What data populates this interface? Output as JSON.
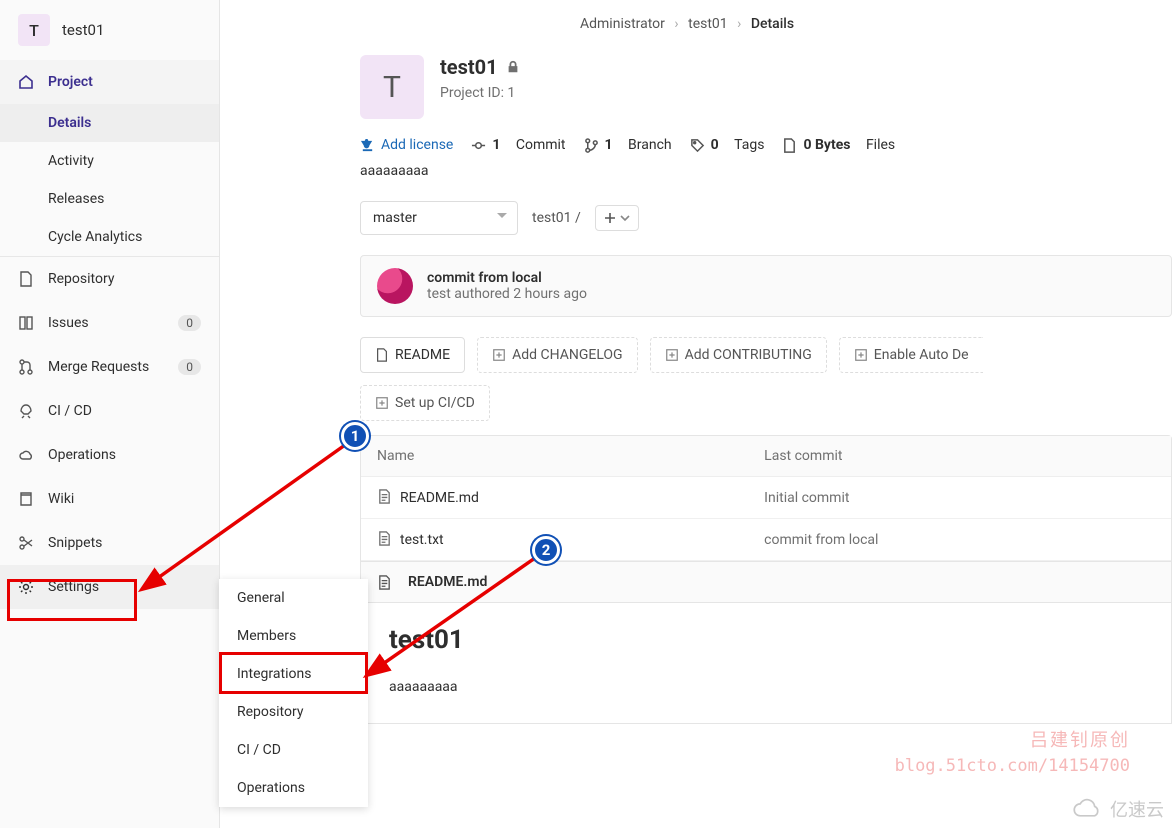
{
  "project": {
    "avatar_letter": "T",
    "name": "test01",
    "id_label": "Project ID: 1",
    "description": "aaaaaaaaa"
  },
  "breadcrumb": {
    "root": "Administrator",
    "project": "test01",
    "current": "Details"
  },
  "sidebar": {
    "top_label": "Project",
    "subs": [
      "Details",
      "Activity",
      "Releases",
      "Cycle Analytics"
    ],
    "items": [
      {
        "label": "Repository"
      },
      {
        "label": "Issues",
        "badge": "0"
      },
      {
        "label": "Merge Requests",
        "badge": "0"
      },
      {
        "label": "CI / CD"
      },
      {
        "label": "Operations"
      },
      {
        "label": "Wiki"
      },
      {
        "label": "Snippets"
      },
      {
        "label": "Settings"
      }
    ]
  },
  "settings_submenu": [
    "General",
    "Members",
    "Integrations",
    "Repository",
    "CI / CD",
    "Operations"
  ],
  "stats": {
    "add_license": "Add license",
    "commits": "1",
    "commits_label": "Commit",
    "branches": "1",
    "branches_label": "Branch",
    "tags": "0",
    "tags_label": "Tags",
    "size": "0 Bytes",
    "size_label": "Files"
  },
  "branch": {
    "selected": "master",
    "path": "test01",
    "sep": "/"
  },
  "commit": {
    "message": "commit from local",
    "meta": "test authored 2 hours ago"
  },
  "actions": {
    "readme": "README",
    "changelog": "Add CHANGELOG",
    "contributing": "Add CONTRIBUTING",
    "auto": "Enable Auto De",
    "cicd": "Set up CI/CD"
  },
  "file_table": {
    "cols": {
      "name": "Name",
      "last": "Last commit"
    },
    "rows": [
      {
        "name": "README.md",
        "last": "Initial commit"
      },
      {
        "name": "test.txt",
        "last": "commit from local"
      }
    ]
  },
  "readme": {
    "file": "README.md",
    "title": "test01",
    "body": "aaaaaaaaa"
  },
  "markers": {
    "one": "1",
    "two": "2"
  },
  "watermarks": {
    "line1": "吕建钊原创",
    "line2": "blog.51cto.com/14154700",
    "corner": "亿速云"
  }
}
